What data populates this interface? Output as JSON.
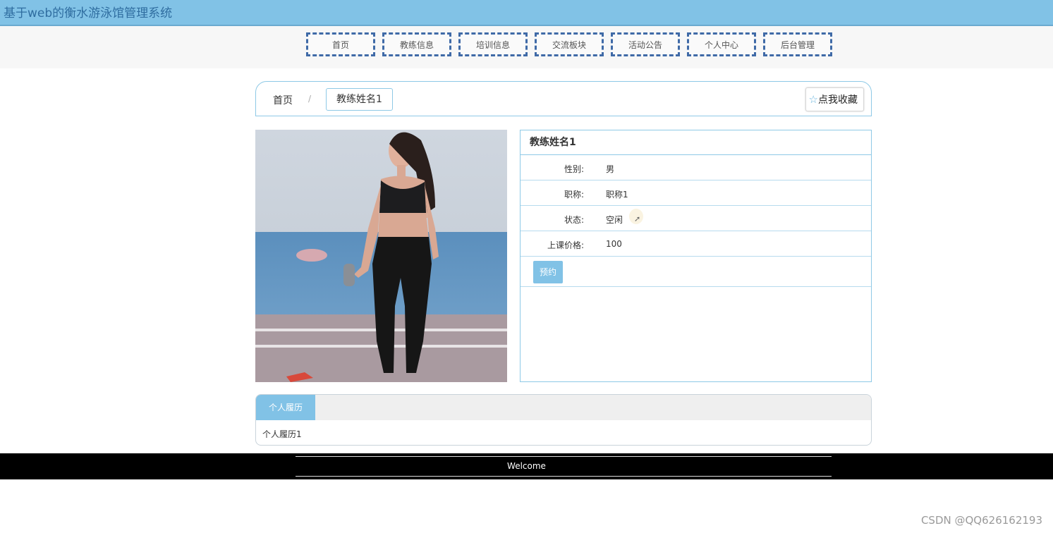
{
  "site": {
    "title": "基于web的衡水游泳馆管理系统"
  },
  "nav": {
    "items": [
      {
        "label": "首页"
      },
      {
        "label": "教练信息"
      },
      {
        "label": "培训信息"
      },
      {
        "label": "交流板块"
      },
      {
        "label": "活动公告"
      },
      {
        "label": "个人中心"
      },
      {
        "label": "后台管理"
      }
    ]
  },
  "breadcrumb": {
    "home": "首页",
    "separator": "/",
    "current": "教练姓名1"
  },
  "favorite": {
    "label": "点我收藏",
    "icon": "star-icon"
  },
  "coach": {
    "photo_alt": "coach-photo",
    "name": "教练姓名1",
    "fields": [
      {
        "label": "性别:",
        "value": "男"
      },
      {
        "label": "职称:",
        "value": "职称1"
      },
      {
        "label": "状态:",
        "value": "空闲"
      },
      {
        "label": "上课价格:",
        "value": "100"
      }
    ],
    "book_label": "预约"
  },
  "resume": {
    "tab_label": "个人履历",
    "content": "个人履历1"
  },
  "footer": {
    "text": "Welcome"
  },
  "watermark": "CSDN @QQ626162193",
  "colors": {
    "accent": "#81c2e6",
    "nav_border": "#3f6aa7",
    "footer_bg": "#000000"
  }
}
